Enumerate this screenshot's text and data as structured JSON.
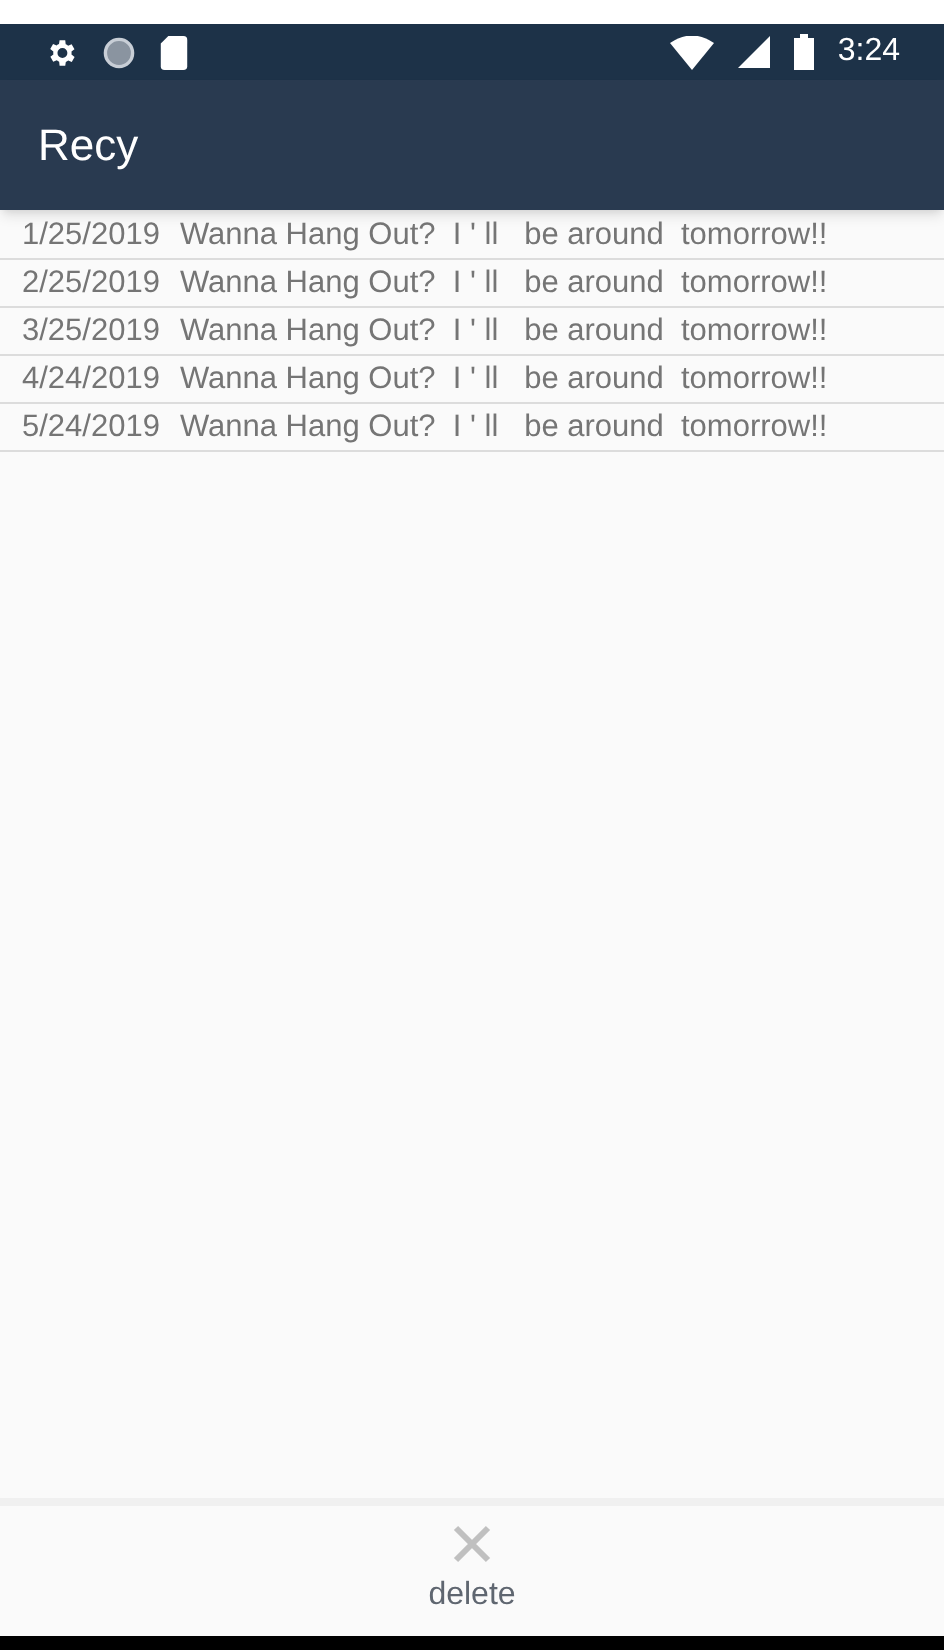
{
  "status_bar": {
    "time": "3:24"
  },
  "app_bar": {
    "title": "Recy"
  },
  "rows": [
    {
      "date": "1/25/2019",
      "message": "Wanna Hang Out?  I ' ll   be around  tomorrow!!"
    },
    {
      "date": "2/25/2019",
      "message": "Wanna Hang Out?  I ' ll   be around  tomorrow!!"
    },
    {
      "date": "3/25/2019",
      "message": "Wanna Hang Out?  I ' ll   be around  tomorrow!!"
    },
    {
      "date": "4/24/2019",
      "message": "Wanna Hang Out?  I ' ll   be around  tomorrow!!"
    },
    {
      "date": "5/24/2019",
      "message": "Wanna Hang Out?  I ' ll   be around  tomorrow!!"
    }
  ],
  "bottom_action": {
    "label": "delete"
  }
}
